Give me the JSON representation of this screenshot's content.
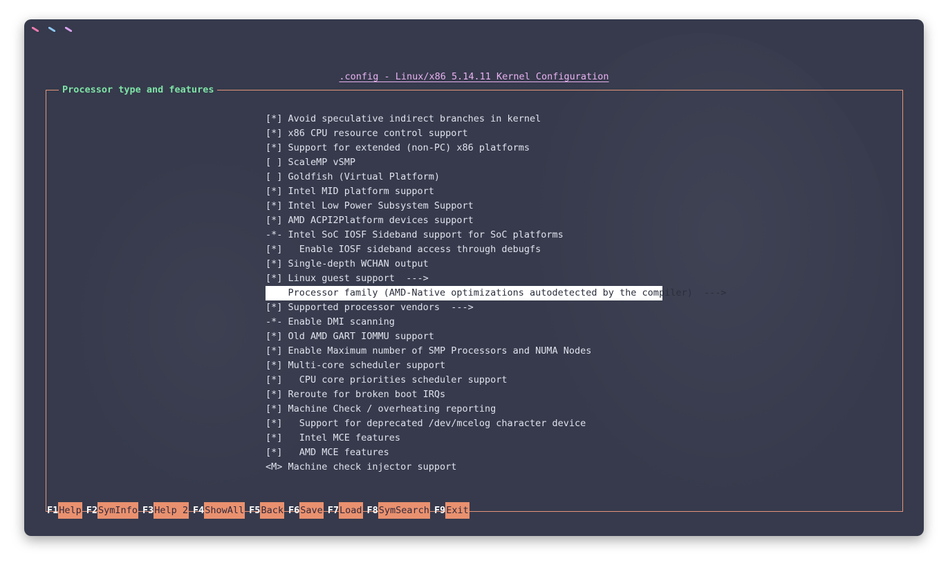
{
  "window": {
    "title": ".config - Linux/x86 5.14.11 Kernel Configuration",
    "controls": [
      {
        "name": "close",
        "color": "#f27ab0"
      },
      {
        "name": "minimize",
        "color": "#8ec6f2"
      },
      {
        "name": "maximize",
        "color": "#d9a3f0"
      }
    ]
  },
  "section_title": "Processor type and features",
  "menu_items": [
    "[*] Avoid speculative indirect branches in kernel",
    "[*] x86 CPU resource control support",
    "[*] Support for extended (non-PC) x86 platforms",
    "[ ] ScaleMP vSMP",
    "[ ] Goldfish (Virtual Platform)",
    "[*] Intel MID platform support",
    "[*] Intel Low Power Subsystem Support",
    "[*] AMD ACPI2Platform devices support",
    "-*- Intel SoC IOSF Sideband support for SoC platforms",
    "[*]   Enable IOSF sideband access through debugfs",
    "[*] Single-depth WCHAN output",
    "[*] Linux guest support  --->",
    "    Processor family (AMD-Native optimizations autodetected by the compiler)  --->",
    "[*] Supported processor vendors  --->",
    "-*- Enable DMI scanning",
    "[*] Old AMD GART IOMMU support",
    "[*] Enable Maximum number of SMP Processors and NUMA Nodes",
    "[*] Multi-core scheduler support",
    "[*]   CPU core priorities scheduler support",
    "[*] Reroute for broken boot IRQs",
    "[*] Machine Check / overheating reporting",
    "[*]   Support for deprecated /dev/mcelog character device",
    "[*]   Intel MCE features",
    "[*]   AMD MCE features",
    "<M> Machine check injector support"
  ],
  "selected_index": 12,
  "function_keys": [
    {
      "key": "F1",
      "label": "Help"
    },
    {
      "key": "F2",
      "label": "SymInfo"
    },
    {
      "key": "F3",
      "label": "Help 2"
    },
    {
      "key": "F4",
      "label": "ShowAll"
    },
    {
      "key": "F5",
      "label": "Back"
    },
    {
      "key": "F6",
      "label": "Save"
    },
    {
      "key": "F7",
      "label": "Load"
    },
    {
      "key": "F8",
      "label": "SymSearch"
    },
    {
      "key": "F9",
      "label": "Exit"
    }
  ],
  "colors": {
    "background": "#363a4c",
    "border": "#e7957b",
    "title": "#e9b1f2",
    "section_title": "#7ee3a6",
    "fkey_label_bg": "#e9916f"
  }
}
